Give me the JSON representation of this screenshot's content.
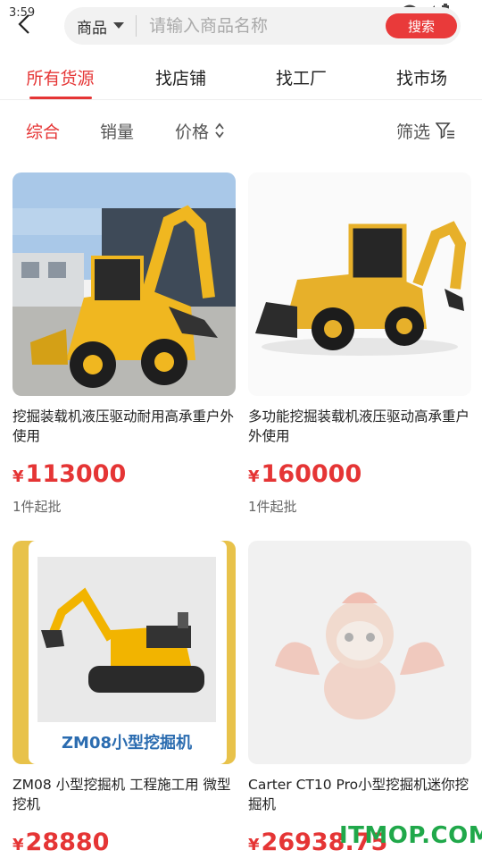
{
  "status": {
    "time": "3:59"
  },
  "search": {
    "type_label": "商品",
    "placeholder": "请输入商品名称",
    "button_label": "搜索"
  },
  "tabs": [
    {
      "label": "所有货源",
      "active": true
    },
    {
      "label": "找店铺",
      "active": false
    },
    {
      "label": "找工厂",
      "active": false
    },
    {
      "label": "找市场",
      "active": false
    }
  ],
  "sort": {
    "comprehensive": "综合",
    "sales": "销量",
    "price": "价格",
    "filter": "筛选"
  },
  "products": [
    {
      "title": "挖掘装载机液压驱动耐用高承重户外使用",
      "currency": "¥",
      "price": "113000",
      "moq": "1件起批",
      "image": "backhoe-loader-outdoor-photo"
    },
    {
      "title": "多功能挖掘装载机液压驱动高承重户外使用",
      "currency": "¥",
      "price": "160000",
      "moq": "1件起批",
      "image": "backhoe-loader-white-background"
    },
    {
      "title": "ZM08 小型挖掘机 工程施工用 微型挖机",
      "currency": "¥",
      "price": "28880",
      "image": "mini-excavator-zm08",
      "image_caption": "ZM08小型挖掘机"
    },
    {
      "title": "Carter CT10 Pro小型挖掘机迷你挖掘机",
      "currency": "¥",
      "price": "26938.75",
      "image": "placeholder-mascot"
    }
  ],
  "watermark": "ITMOP.COM",
  "colors": {
    "accent": "#e53535",
    "search_button": "#e93a3a"
  }
}
